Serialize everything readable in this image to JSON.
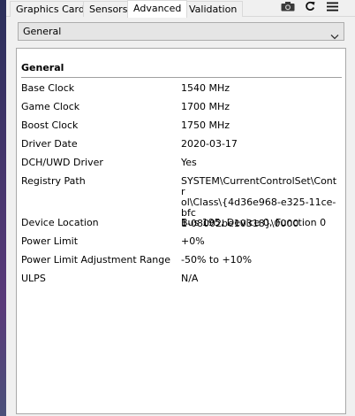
{
  "tabs": [
    {
      "label": "Graphics Card",
      "active": false
    },
    {
      "label": "Sensors",
      "active": false
    },
    {
      "label": "Advanced",
      "active": true
    },
    {
      "label": "Validation",
      "active": false
    }
  ],
  "toolbar": {
    "icons": [
      "camera-icon",
      "refresh-icon",
      "menu-icon"
    ]
  },
  "category_select": {
    "value": "General"
  },
  "section": {
    "title": "General",
    "rows": [
      {
        "key": "Base Clock",
        "value": "1540 MHz"
      },
      {
        "key": "Game Clock",
        "value": "1700 MHz"
      },
      {
        "key": "Boost Clock",
        "value": "1750 MHz"
      },
      {
        "key": "Driver Date",
        "value": "2020-03-17"
      },
      {
        "key": "DCH/UWD Driver",
        "value": "Yes"
      },
      {
        "key": "Registry Path",
        "value_lines": [
          "SYSTEM\\CurrentControlSet\\Contr",
          "ol\\Class\\{4d36e968-e325-11ce-bfc",
          "1-08002be10318}\\0000"
        ]
      },
      {
        "key": "Device Location",
        "value": "Bus 195, Device 0, Function 0"
      },
      {
        "key": "Power Limit",
        "value": "+0%"
      },
      {
        "key": "Power Limit Adjustment Range",
        "value": "-50% to +10%"
      },
      {
        "key": "ULPS",
        "value": "N/A"
      }
    ]
  }
}
